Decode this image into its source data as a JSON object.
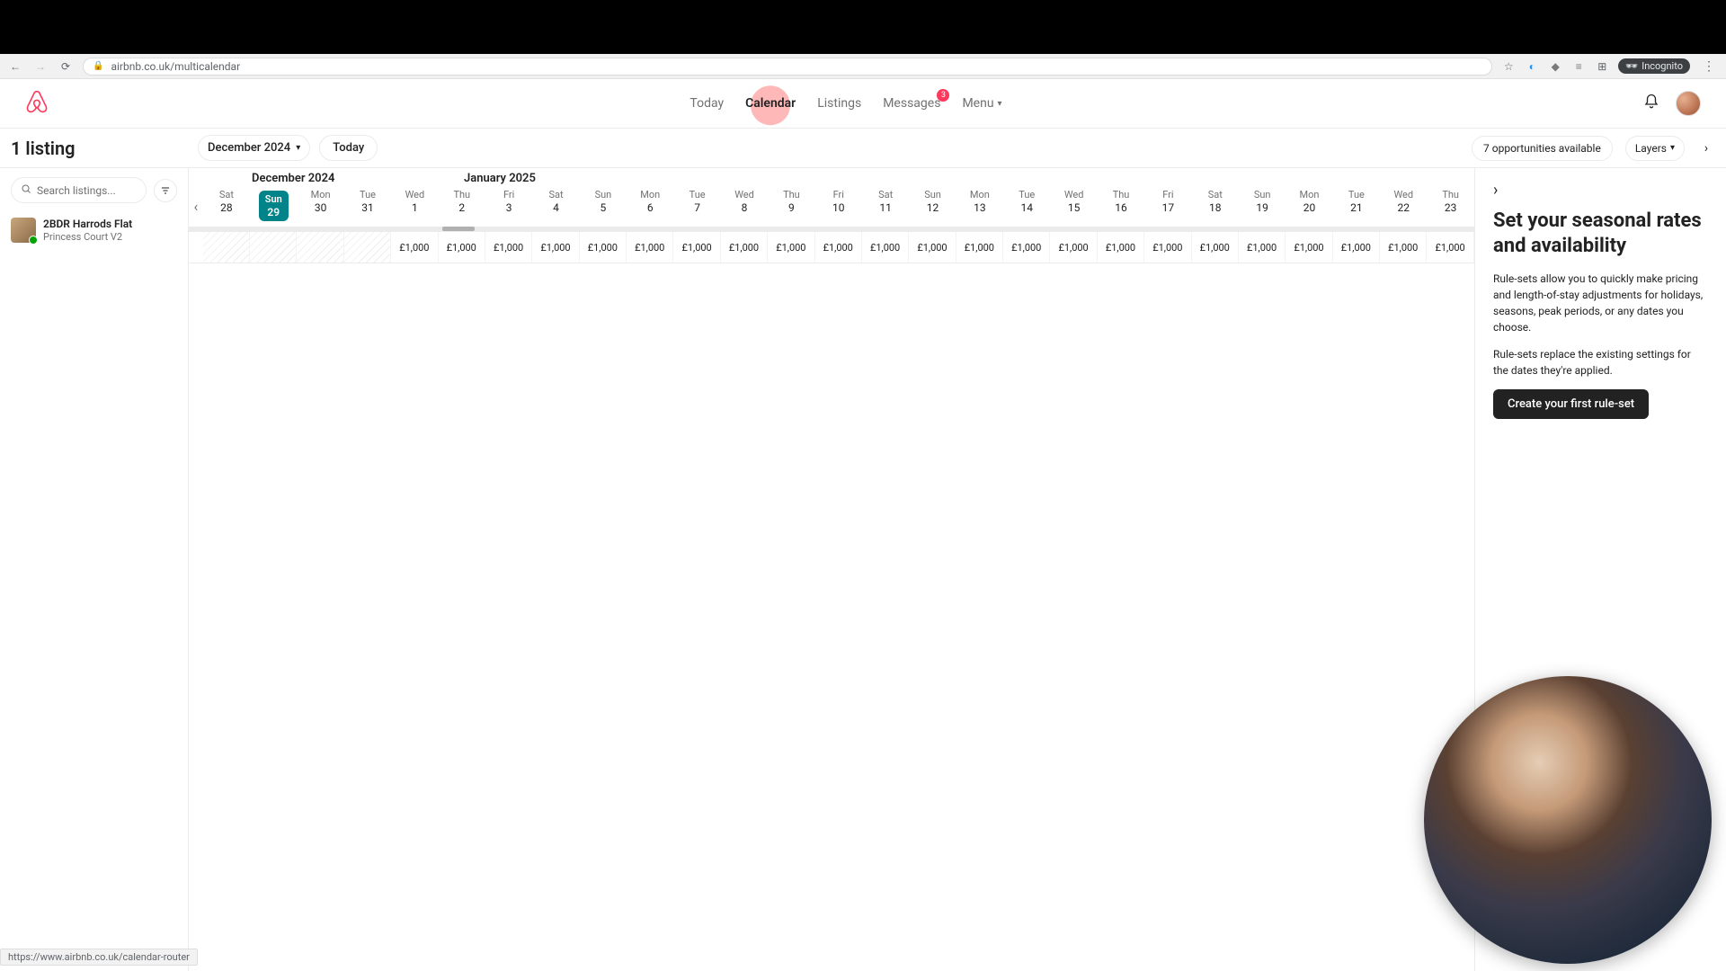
{
  "browser": {
    "url": "airbnb.co.uk/multicalendar",
    "incognito_label": "Incognito"
  },
  "header": {
    "nav": {
      "today": "Today",
      "calendar": "Calendar",
      "listings": "Listings",
      "messages": "Messages",
      "messages_badge": "3",
      "menu": "Menu"
    }
  },
  "toolbar": {
    "listing_count": "1 listing",
    "month_select": "December 2024",
    "today_button": "Today",
    "opportunities": "7 opportunities available",
    "layers": "Layers"
  },
  "sidebar": {
    "search_placeholder": "Search listings...",
    "listing": {
      "name": "2BDR Harrods Flat",
      "subtitle": "Princess Court V2"
    }
  },
  "calendar": {
    "months": {
      "dec": "December 2024",
      "jan": "January 2025"
    },
    "days": [
      {
        "dow": "Sat",
        "num": "28",
        "blocked": true
      },
      {
        "dow": "Sun",
        "num": "29",
        "blocked": true,
        "today": true
      },
      {
        "dow": "Mon",
        "num": "30",
        "blocked": true
      },
      {
        "dow": "Tue",
        "num": "31",
        "blocked": true
      },
      {
        "dow": "Wed",
        "num": "1"
      },
      {
        "dow": "Thu",
        "num": "2"
      },
      {
        "dow": "Fri",
        "num": "3"
      },
      {
        "dow": "Sat",
        "num": "4"
      },
      {
        "dow": "Sun",
        "num": "5"
      },
      {
        "dow": "Mon",
        "num": "6"
      },
      {
        "dow": "Tue",
        "num": "7"
      },
      {
        "dow": "Wed",
        "num": "8"
      },
      {
        "dow": "Thu",
        "num": "9"
      },
      {
        "dow": "Fri",
        "num": "10"
      },
      {
        "dow": "Sat",
        "num": "11"
      },
      {
        "dow": "Sun",
        "num": "12"
      },
      {
        "dow": "Mon",
        "num": "13"
      },
      {
        "dow": "Tue",
        "num": "14"
      },
      {
        "dow": "Wed",
        "num": "15"
      },
      {
        "dow": "Thu",
        "num": "16"
      },
      {
        "dow": "Fri",
        "num": "17"
      },
      {
        "dow": "Sat",
        "num": "18"
      },
      {
        "dow": "Sun",
        "num": "19"
      },
      {
        "dow": "Mon",
        "num": "20"
      },
      {
        "dow": "Tue",
        "num": "21"
      },
      {
        "dow": "Wed",
        "num": "22"
      },
      {
        "dow": "Thu",
        "num": "23"
      }
    ],
    "price": "£1,000"
  },
  "panel": {
    "title": "Set your seasonal rates and availability",
    "p1": "Rule-sets allow you to quickly make pricing and length-of-stay adjustments for holidays, seasons, peak periods, or any dates you choose.",
    "p2": "Rule-sets replace the existing settings for the dates they're applied.",
    "cta": "Create your first rule-set"
  },
  "statusbar": "https://www.airbnb.co.uk/calendar-router"
}
